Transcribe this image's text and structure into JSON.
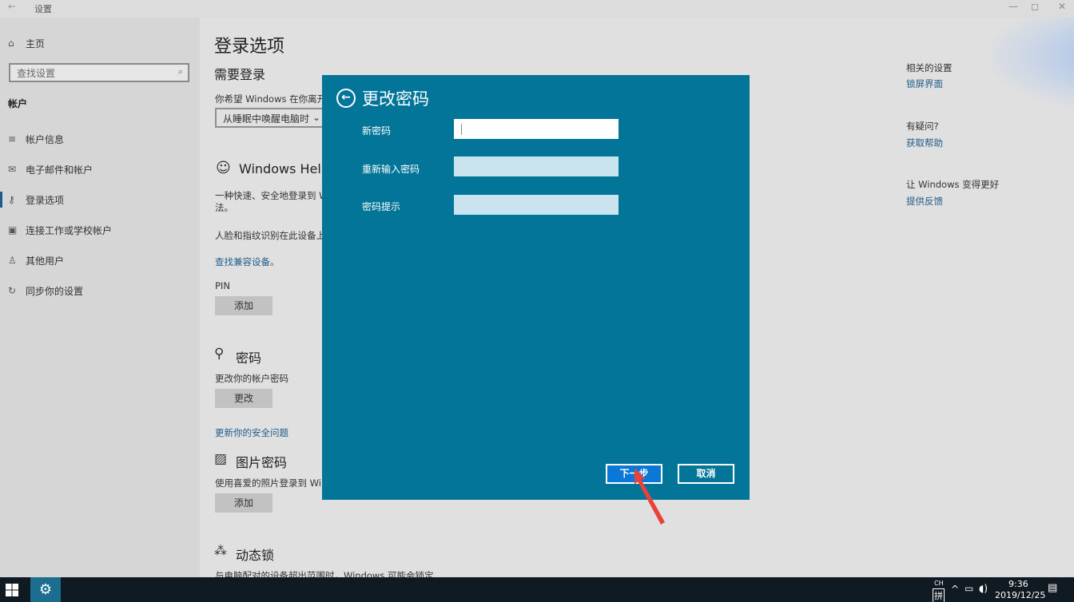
{
  "window": {
    "title": "设置",
    "back_icon": "←",
    "minimize": "—",
    "maximize": "◻",
    "close": "✕"
  },
  "sidebar": {
    "home": "主页",
    "search_placeholder": "查找设置",
    "section": "帐户",
    "items": [
      {
        "label": "帐户信息",
        "icon": "person-list-icon"
      },
      {
        "label": "电子邮件和帐户",
        "icon": "mail-icon"
      },
      {
        "label": "登录选项",
        "icon": "key-icon"
      },
      {
        "label": "连接工作或学校帐户",
        "icon": "briefcase-icon"
      },
      {
        "label": "其他用户",
        "icon": "person-add-icon"
      },
      {
        "label": "同步你的设置",
        "icon": "sync-icon"
      }
    ]
  },
  "main": {
    "title": "登录选项",
    "require_signin_heading": "需要登录",
    "require_signin_desc": "你希望 Windows 在你离开电",
    "dropdown_value": "从睡眠中唤醒电脑时",
    "hello_heading": "Windows Hello",
    "hello_desc_1": "一种快速、安全地登录到 W",
    "hello_desc_2": "法。",
    "hello_face": "人脸和指纹识别在此设备上",
    "find_devices": "查找兼容设备。",
    "pin_label": "PIN",
    "pin_add": "添加",
    "password_heading": "密码",
    "password_desc": "更改你的帐户密码",
    "password_change": "更改",
    "security_questions": "更新你的安全问题",
    "picture_heading": "图片密码",
    "picture_desc": "使用喜爱的照片登录到 Win",
    "picture_add": "添加",
    "dynamic_lock_heading": "动态锁",
    "dynamic_lock_desc": "与电脑配对的设备超出范围时，Windows 可能会锁定"
  },
  "right": {
    "related_heading": "相关的设置",
    "lock_screen": "锁屏界面",
    "question_heading": "有疑问?",
    "get_help": "获取帮助",
    "improve_heading": "让 Windows 变得更好",
    "feedback": "提供反馈"
  },
  "dialog": {
    "title": "更改密码",
    "new_password_label": "新密码",
    "reenter_label": "重新输入密码",
    "hint_label": "密码提示",
    "new_password_value": "",
    "reenter_value": "",
    "hint_value": "",
    "next_button": "下一步",
    "cancel_button": "取消",
    "accent_color": "#037598"
  },
  "taskbar": {
    "ime_top": "CH",
    "ime_bottom": "拼",
    "caret": "^",
    "time": "9:36",
    "date": "2019/12/25"
  }
}
